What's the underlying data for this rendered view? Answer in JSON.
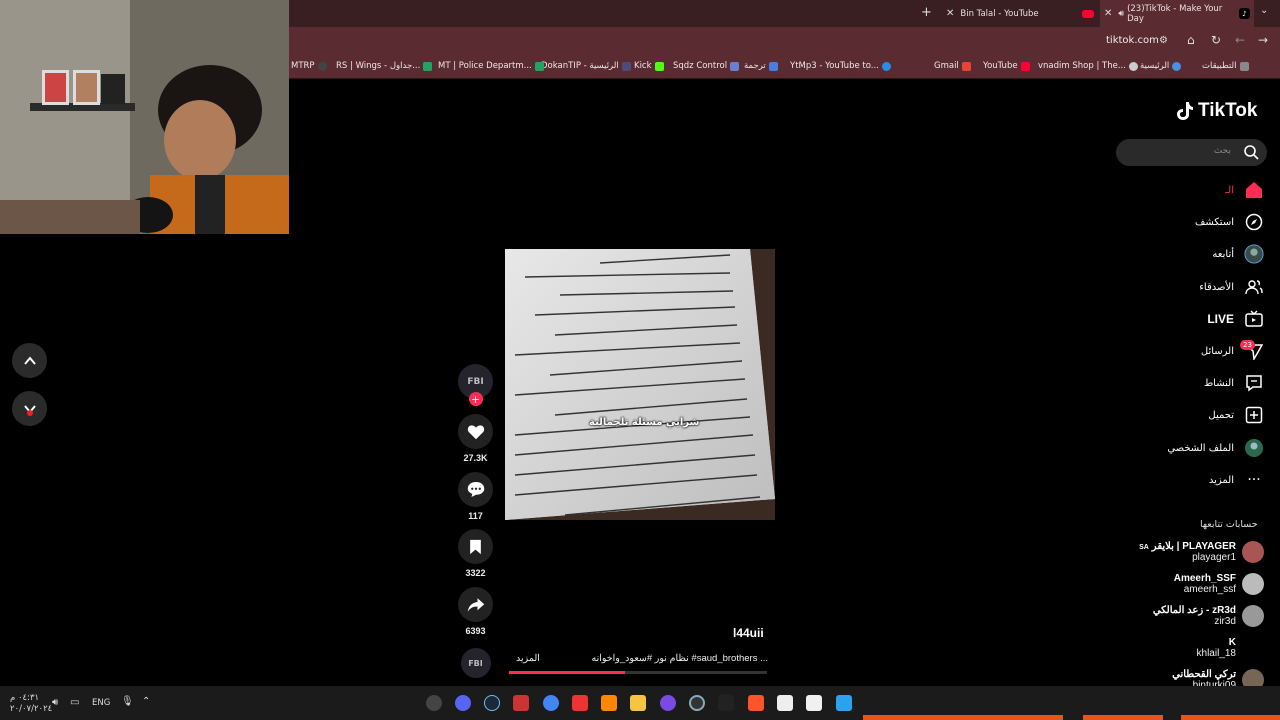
{
  "browser": {
    "tabs": [
      {
        "title": "Bin Talal - YouTube",
        "active": false
      },
      {
        "title": "(23)TikTok - Make Your Day",
        "active": true
      }
    ],
    "url": "tiktok.com",
    "bookmarks": [
      "التطبيقات",
      "الرئيسية",
      "vnadim Shop | The...",
      "YouTube",
      "Gmail",
      "YtMp3 - YouTube to...",
      "ترجمة",
      "Sqdz Control",
      "Kick",
      "DokanTIP - الرئيسية",
      "MT | Police Departm...",
      "RS | Wings - جداول...",
      "MTRP"
    ]
  },
  "tiktok": {
    "logo": "TikTok",
    "search_placeholder": "بحث",
    "nav": {
      "home": "الـ",
      "explore": "استكشف",
      "following": "أتابعه",
      "friends": "الأصدقاء",
      "live": "LIVE",
      "messages": "الرسائل",
      "messages_badge": "23",
      "activity": "النشاط",
      "upload": "تحميل",
      "profile": "الملف الشخصي",
      "more": "المزيد"
    },
    "following_title": "حسابات تتابعها",
    "accounts": [
      {
        "name": "بلايقر | PLAYAGER",
        "flag": "SA",
        "handle": "playager1"
      },
      {
        "name": "Ameerh_SSF",
        "handle": "ameerh_ssf"
      },
      {
        "name": "زعد المالكي - zR3d",
        "handle": "zir3d"
      },
      {
        "name": "K",
        "handle": "khlail_18"
      },
      {
        "name": "تركي القحطاني",
        "handle": "binturki09"
      }
    ],
    "video": {
      "likes": "27.3K",
      "comments": "117",
      "saves": "3322",
      "shares": "6393",
      "author": "l44uii",
      "caption_left": "المزيد",
      "caption_main": "نظام نور #سعود_واخوانه #saud_brothers ...",
      "overlay_text": "شرايي مسئلة تلجمالية",
      "avatar_text": "FBI",
      "progress": 0.45
    }
  },
  "taskbar": {
    "lang": "ENG",
    "time": "٠٤:٣١ م",
    "date": "٢٠/٠٧/٢٠٢٤"
  },
  "colors": {
    "accent": "#fe2c55",
    "chrome": "#5a2c31",
    "tabbar": "#3a1f22"
  }
}
